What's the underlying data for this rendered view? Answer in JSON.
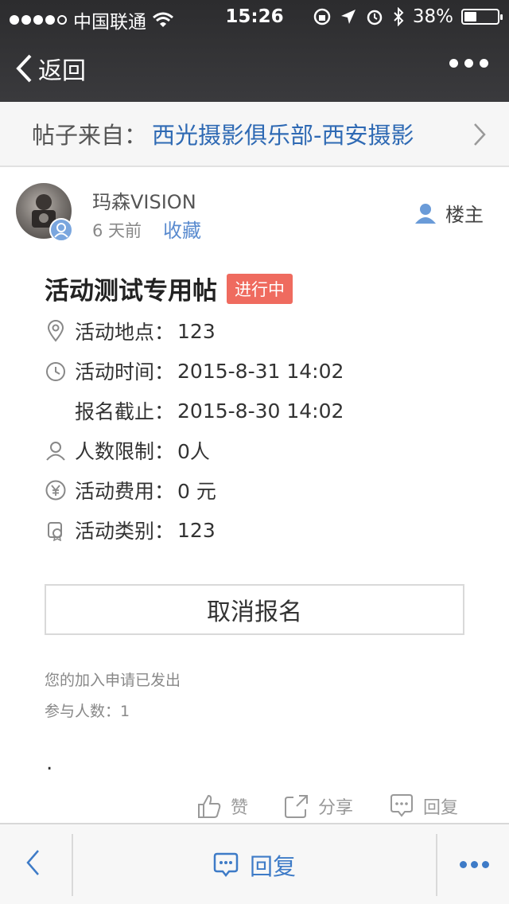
{
  "status_bar": {
    "carrier": "中国联通",
    "time": "15:26",
    "battery_percent": "38%",
    "battery_level": 0.38
  },
  "nav": {
    "back_label": "返回"
  },
  "source": {
    "label": "帖子来自：",
    "link": "西光摄影俱乐部-西安摄影"
  },
  "author": {
    "name": "玛森VISION",
    "time": "6 天前",
    "favorite_label": "收藏",
    "owner_label": "楼主"
  },
  "post": {
    "title": "活动测试专用帖",
    "status_badge": "进行中",
    "location_label": "活动地点：",
    "location_value": "123",
    "time_label": "活动时间：",
    "time_value": "2015-8-31 14:02",
    "deadline_label": "报名截止：",
    "deadline_value": "2015-8-30 14:02",
    "limit_label": "人数限制：",
    "limit_value": "0人",
    "fee_label": "活动费用：",
    "fee_value": "0 元",
    "category_label": "活动类别：",
    "category_value": "123",
    "cancel_button": "取消报名",
    "note_sent": "您的加入申请已发出",
    "participants": "参与人数：1",
    "body_text": "."
  },
  "actions": {
    "like": "赞",
    "share": "分享",
    "reply": "回复"
  },
  "toolbar": {
    "reply": "回复"
  },
  "colors": {
    "link_blue": "#2f6ab4",
    "toolbar_blue": "#3e7bc7",
    "badge_red": "#ef6b5f"
  }
}
